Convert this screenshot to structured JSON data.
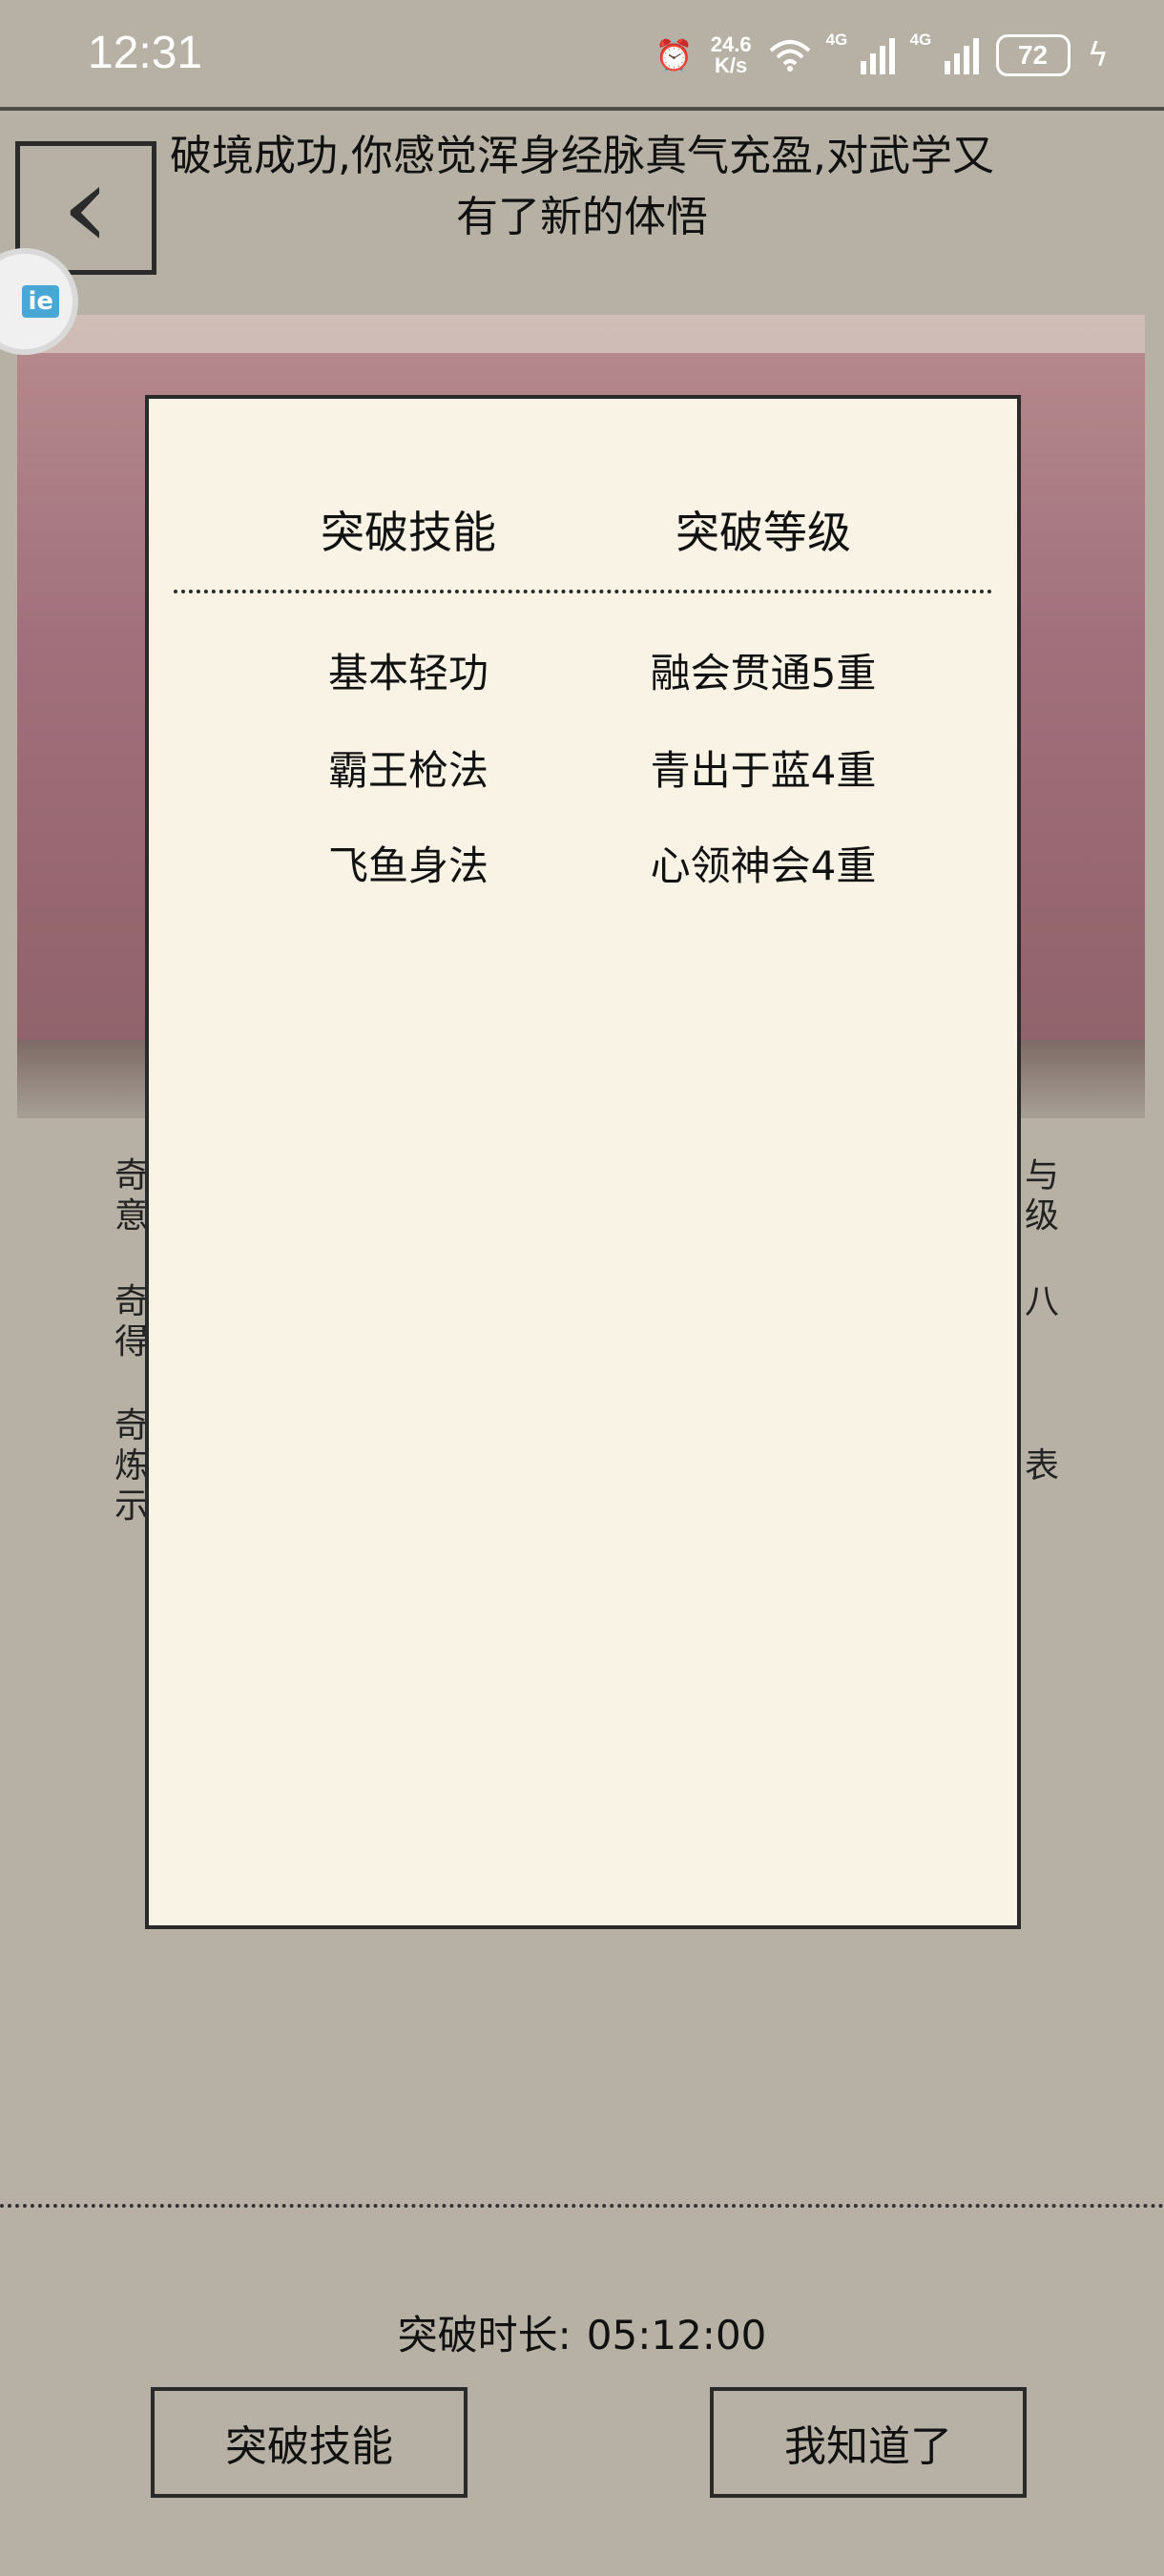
{
  "status_bar": {
    "time": "12:31",
    "net_speed_value": "24.6",
    "net_speed_unit": "K/s",
    "signal1_label": "4G",
    "signal2_label": "4G",
    "battery": "72",
    "icons": [
      "alarm-icon",
      "wifi-icon",
      "signal-icon",
      "signal-icon",
      "battery-icon",
      "charging-icon"
    ]
  },
  "header": {
    "message": "破境成功,你感觉浑身经脉真气充盈,对武学又有了新的体悟"
  },
  "background_text": {
    "p1_line1": "奇",
    "p1_line2": "意",
    "p1_right1": "与",
    "p1_right2": "级",
    "p2_line1": "奇",
    "p2_line2": "得",
    "p2_right1": "八",
    "p3_line1": "奇",
    "p3_line2": "炼",
    "p3_line3": "示",
    "p3_right1": "表"
  },
  "dialog": {
    "col_skill": "突破技能",
    "col_level": "突破等级",
    "rows": [
      {
        "skill": "基本轻功",
        "level": "融会贯通5重"
      },
      {
        "skill": "霸王枪法",
        "level": "青出于蓝4重"
      },
      {
        "skill": "飞鱼身法",
        "level": "心领神会4重"
      }
    ]
  },
  "footer": {
    "duration_label": "突破时长:",
    "duration_value": "05:12:00",
    "btn_skill": "突破技能",
    "btn_ok": "我知道了"
  },
  "colors": {
    "page_bg": "#b7b1a5",
    "dialog_bg": "#f9f3e5",
    "scene": "#a1707c"
  }
}
